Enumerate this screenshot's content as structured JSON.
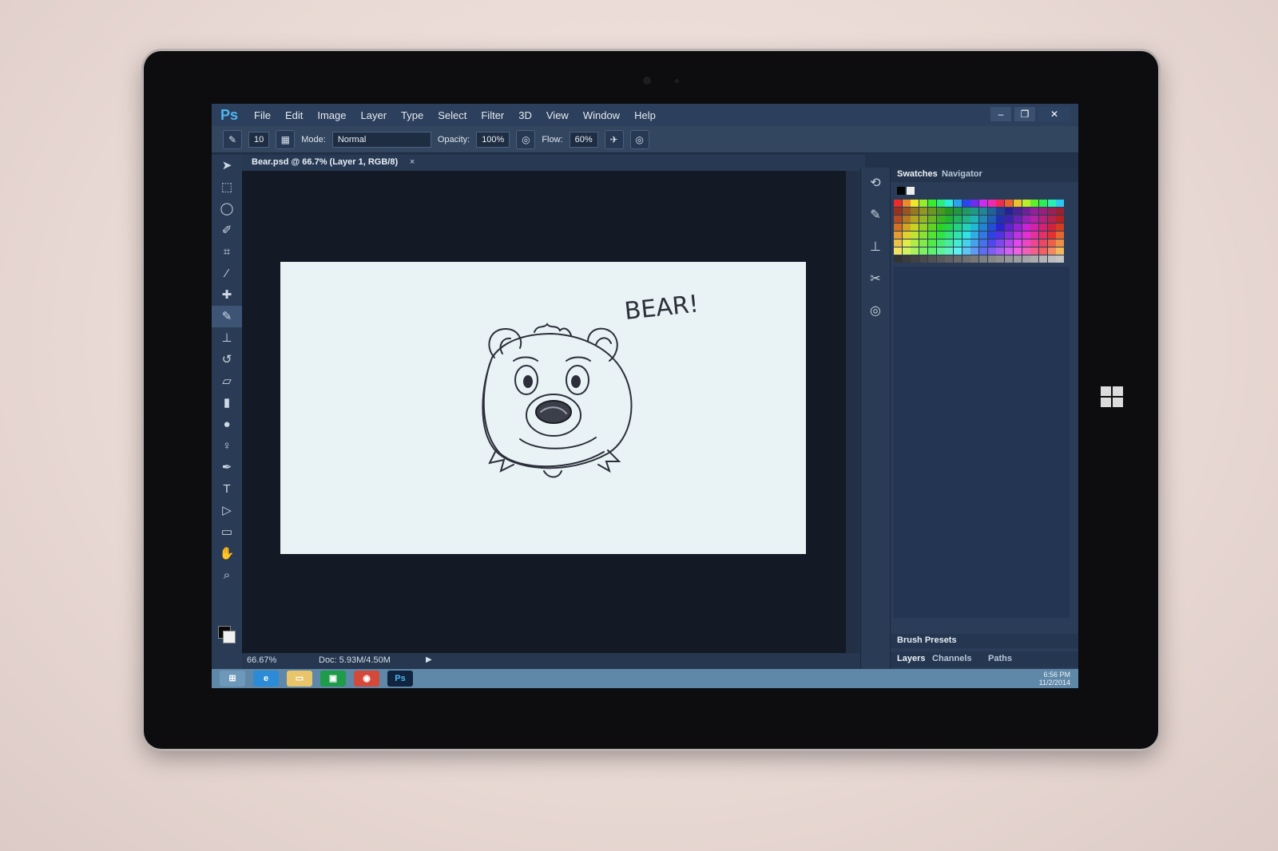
{
  "app": {
    "logo": "Ps",
    "menu": [
      "File",
      "Edit",
      "Image",
      "Layer",
      "Type",
      "Select",
      "Filter",
      "3D",
      "View",
      "Window",
      "Help"
    ],
    "window_buttons": [
      "–",
      "❐",
      "✕"
    ]
  },
  "options_bar": {
    "brush_size": "10",
    "mode_label": "Mode:",
    "mode_value": "Normal",
    "opacity_label": "Opacity:",
    "opacity_value": "100%",
    "flow_label": "Flow:",
    "flow_value": "60%"
  },
  "document": {
    "tab_title": "Bear.psd @ 66.7% (Layer 1, RGB/8)",
    "tab_close": "×",
    "drawing_text": "BEAR!",
    "zoom": "66.67%",
    "doc_info": "Doc: 5.93M/4.50M",
    "status_arrow": "▶"
  },
  "panels": {
    "top_tabs": [
      "Swatches",
      "Navigator"
    ],
    "brush_presets": "Brush Presets",
    "layer_tabs": [
      "Layers",
      "Channels",
      "Paths"
    ]
  },
  "taskbar": {
    "ps_icon": "Ps",
    "time": "6:56 PM",
    "date": "11/2/2014"
  },
  "colors": {
    "accent": "#4fb6f0",
    "ui_dark": "#22324a",
    "canvas": "#e9f3f5",
    "taskbar": "#5e87a8"
  },
  "icons": {
    "tools": [
      "move-icon",
      "marquee-icon",
      "lasso-icon",
      "quick-select-icon",
      "crop-icon",
      "eyedropper-icon",
      "healing-icon",
      "brush-icon",
      "stamp-icon",
      "history-brush-icon",
      "eraser-icon",
      "gradient-icon",
      "blur-icon",
      "dodge-icon",
      "pen-icon",
      "type-icon",
      "path-select-icon",
      "shape-icon",
      "hand-icon",
      "zoom-icon"
    ]
  }
}
